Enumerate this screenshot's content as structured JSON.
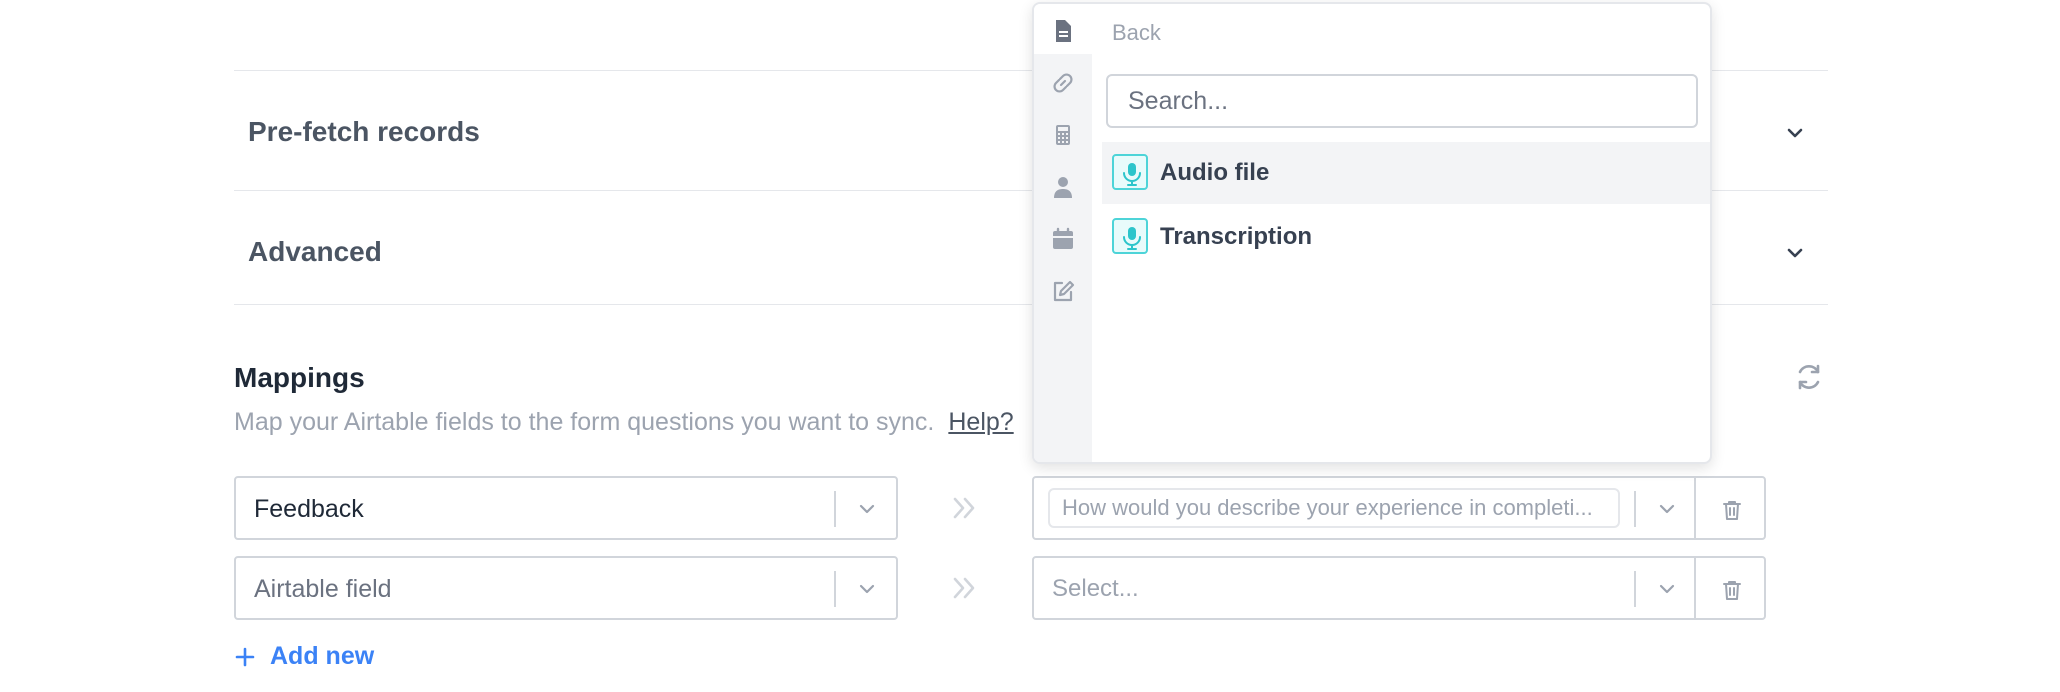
{
  "sections": {
    "prefetch_title": "Pre-fetch records",
    "advanced_title": "Advanced"
  },
  "mappings": {
    "title": "Mappings",
    "description": "Map your Airtable fields to the form questions you want to sync.",
    "help_link": "Help?",
    "rows": [
      {
        "airtable_field": "Feedback",
        "form_question": "How would you describe your experience in completi..."
      },
      {
        "airtable_field": "Airtable field",
        "form_question": "Select..."
      }
    ],
    "add_new": "Add new"
  },
  "popover": {
    "back_label": "Back",
    "search_placeholder": "Search...",
    "options": [
      {
        "label": "Audio file",
        "icon": "microphone-icon",
        "active": true
      },
      {
        "label": "Transcription",
        "icon": "microphone-icon",
        "active": false
      }
    ],
    "rail_icons": [
      "document-icon",
      "link-icon",
      "calculator-icon",
      "person-icon",
      "calendar-icon",
      "edit-icon"
    ]
  },
  "colors": {
    "accent_blue": "#3b82f6",
    "audio_icon": "#4dd4d8",
    "border": "#d1d5db",
    "muted_text": "#9ca3af"
  }
}
